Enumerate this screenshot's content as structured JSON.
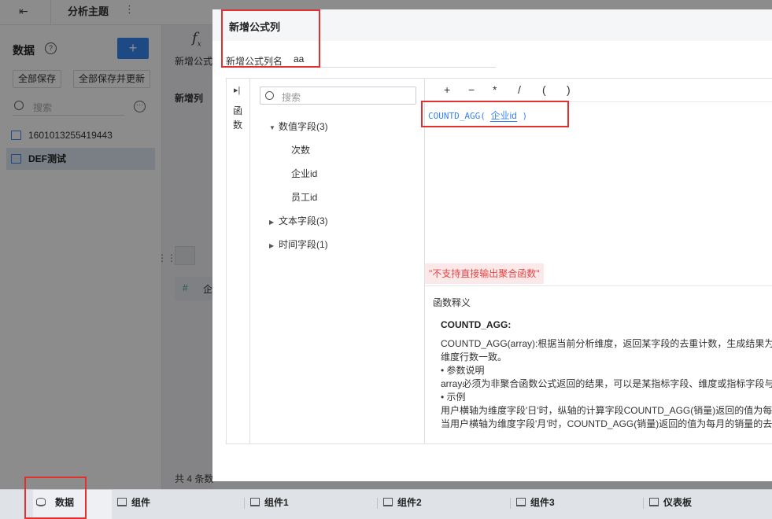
{
  "topbar": {
    "title": "分析主题",
    "dots": "⋮"
  },
  "left_panel": {
    "title": "数据",
    "add_label": "+",
    "save_all": "全部保存",
    "save_all_update": "全部保存并更新",
    "search_placeholder": "搜索",
    "more": "···",
    "items": [
      {
        "label": "1601013255419443"
      },
      {
        "label": "DEF测试"
      }
    ]
  },
  "mid_panel": {
    "fx": "fx",
    "add_formula_col": "新增公式",
    "add_col": "新增列",
    "col_header": "企",
    "count_text": "共 4 条数"
  },
  "dialog": {
    "title": "新增公式列",
    "name_label": "新增公式列名",
    "name_value": "aa",
    "rail_label": "函数",
    "search_placeholder": "搜索",
    "tree": [
      {
        "label": "数值字段(3)",
        "expanded": true,
        "children": [
          "次数",
          "企业id",
          "员工id"
        ]
      },
      {
        "label": "文本字段(3)",
        "expanded": false
      },
      {
        "label": "时间字段(1)",
        "expanded": false
      }
    ],
    "operators": [
      "+",
      "−",
      "*",
      "/",
      "(",
      ")"
    ],
    "formula": {
      "func": "COUNTD_AGG(",
      "field": "企业id",
      "close": ")"
    },
    "error": "\"不支持直接输出聚合函数\"",
    "explain": {
      "title": "函数释义",
      "name": "COUNTD_AGG:",
      "lines": [
        "COUNTD_AGG(array):根据当前分析维度，返回某字段的去重计数，生成结果为",
        "维度行数一致。",
        "• 参数说明",
        "array必须为非聚合函数公式返回的结果，可以是某指标字段、维度或指标字段与",
        "• 示例",
        "用户横轴为维度字段'日'时，纵轴的计算字段COUNTD_AGG(销量)返回的值为每",
        "当用户横轴为维度字段'月'时，COUNTD_AGG(销量)返回的值为每月的销量的去"
      ]
    }
  },
  "bottom_tabs": [
    {
      "label": "数据",
      "icon": "database-icon"
    },
    {
      "label": "组件",
      "icon": "chart-icon"
    },
    {
      "label": "组件1",
      "icon": "chart-icon"
    },
    {
      "label": "组件2",
      "icon": "chart-icon"
    },
    {
      "label": "组件3",
      "icon": "chart-icon"
    },
    {
      "label": "仪表板",
      "icon": "dashboard-icon"
    }
  ],
  "colors": {
    "accent": "#3685f2",
    "error": "#e64545",
    "annotation": "#e03030"
  }
}
